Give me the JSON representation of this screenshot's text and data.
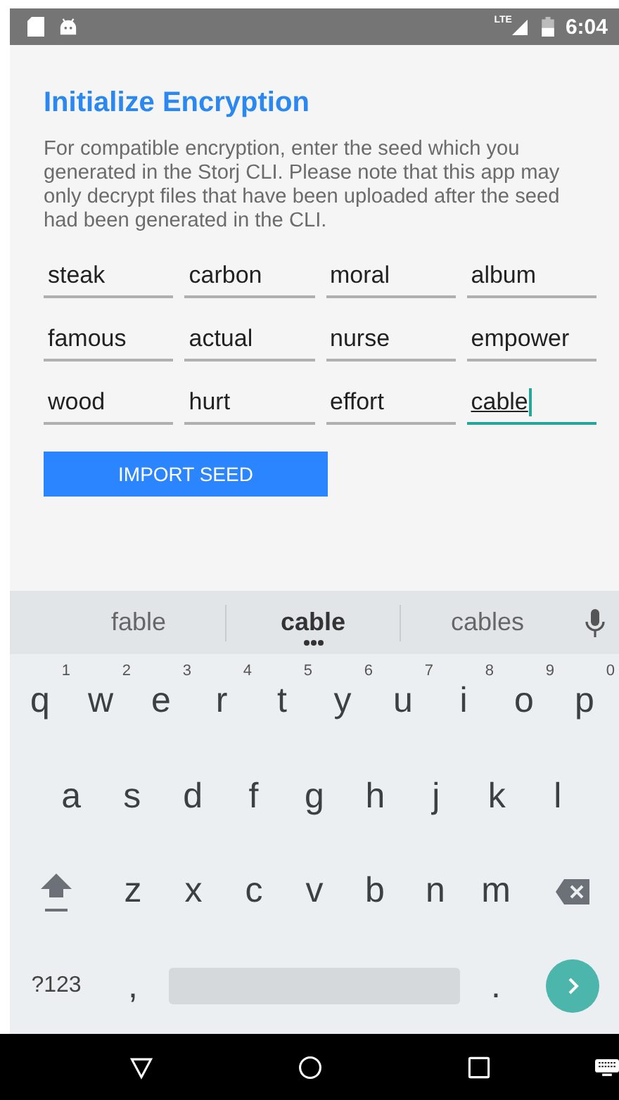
{
  "status_bar": {
    "network": "LTE",
    "time": "6:04"
  },
  "title": "Initialize Encryption",
  "description": "For compatible encryption, enter the seed which you generated in the Storj CLI. Please note that this app may only decrypt files that have been uploaded after the seed had been generated in the CLI.",
  "seed_words": [
    {
      "value": "steak",
      "focused": false
    },
    {
      "value": "carbon",
      "focused": false
    },
    {
      "value": "moral",
      "focused": false
    },
    {
      "value": "album",
      "focused": false
    },
    {
      "value": "famous",
      "focused": false
    },
    {
      "value": "actual",
      "focused": false
    },
    {
      "value": "nurse",
      "focused": false
    },
    {
      "value": "empower",
      "focused": false
    },
    {
      "value": "wood",
      "focused": false
    },
    {
      "value": "hurt",
      "focused": false
    },
    {
      "value": "effort",
      "focused": false
    },
    {
      "value": "cable",
      "focused": true
    }
  ],
  "import_button": "IMPORT SEED",
  "keyboard": {
    "suggestions": [
      {
        "text": "fable",
        "selected": false
      },
      {
        "text": "cable",
        "selected": true
      },
      {
        "text": "cables",
        "selected": false
      }
    ],
    "rows": [
      [
        {
          "kind": "letter",
          "label": "q",
          "hint": "1"
        },
        {
          "kind": "letter",
          "label": "w",
          "hint": "2"
        },
        {
          "kind": "letter",
          "label": "e",
          "hint": "3"
        },
        {
          "kind": "letter",
          "label": "r",
          "hint": "4"
        },
        {
          "kind": "letter",
          "label": "t",
          "hint": "5"
        },
        {
          "kind": "letter",
          "label": "y",
          "hint": "6"
        },
        {
          "kind": "letter",
          "label": "u",
          "hint": "7"
        },
        {
          "kind": "letter",
          "label": "i",
          "hint": "8"
        },
        {
          "kind": "letter",
          "label": "o",
          "hint": "9"
        },
        {
          "kind": "letter",
          "label": "p",
          "hint": "0"
        }
      ],
      [
        {
          "kind": "letter",
          "label": "a"
        },
        {
          "kind": "letter",
          "label": "s"
        },
        {
          "kind": "letter",
          "label": "d"
        },
        {
          "kind": "letter",
          "label": "f"
        },
        {
          "kind": "letter",
          "label": "g"
        },
        {
          "kind": "letter",
          "label": "h"
        },
        {
          "kind": "letter",
          "label": "j"
        },
        {
          "kind": "letter",
          "label": "k"
        },
        {
          "kind": "letter",
          "label": "l"
        }
      ],
      [
        {
          "kind": "shift"
        },
        {
          "kind": "letter",
          "label": "z"
        },
        {
          "kind": "letter",
          "label": "x"
        },
        {
          "kind": "letter",
          "label": "c"
        },
        {
          "kind": "letter",
          "label": "v"
        },
        {
          "kind": "letter",
          "label": "b"
        },
        {
          "kind": "letter",
          "label": "n"
        },
        {
          "kind": "letter",
          "label": "m"
        },
        {
          "kind": "backspace"
        }
      ]
    ],
    "bottom_row": {
      "symbols_key": "?123",
      "comma_key": ",",
      "period_key": "."
    }
  }
}
